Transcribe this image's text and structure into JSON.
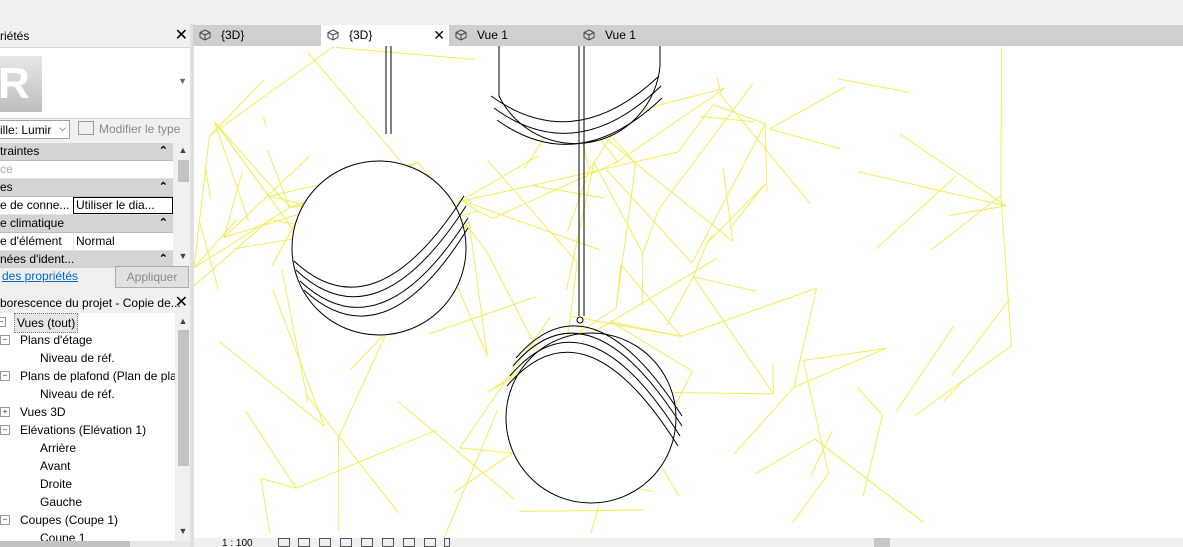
{
  "properties": {
    "title": "riétés",
    "close_icon": "close-icon",
    "family_type": "ille: Lumir",
    "edit_type": "Modifier le type",
    "groups": [
      {
        "label": "traintes",
        "rows": [
          {
            "name": "ce",
            "value": ""
          }
        ]
      },
      {
        "label": "es",
        "rows": [
          {
            "name": "e de conne...",
            "value": "Utiliser le dia..."
          }
        ]
      },
      {
        "label": "e climatique",
        "rows": [
          {
            "name": "e d'élément",
            "value": "Normal"
          }
        ]
      },
      {
        "label": "nées d'ident...",
        "rows": []
      }
    ],
    "help_link": "des propriétés",
    "apply": "Appliquer"
  },
  "browser": {
    "title": "borescence du projet - Copie de...",
    "items": [
      {
        "label": "Vues (tout)",
        "level": 0,
        "toggle": "-",
        "selected": true
      },
      {
        "label": "Plans d'étage",
        "level": 1,
        "toggle": "-"
      },
      {
        "label": "Niveau de réf.",
        "level": 2
      },
      {
        "label": "Plans de plafond (Plan de pla",
        "level": 1,
        "toggle": "-"
      },
      {
        "label": "Niveau de réf.",
        "level": 2
      },
      {
        "label": "Vues 3D",
        "level": 1,
        "toggle": "+"
      },
      {
        "label": "Elévations (Elévation 1)",
        "level": 1,
        "toggle": "-"
      },
      {
        "label": "Arrière",
        "level": 2
      },
      {
        "label": "Avant",
        "level": 2
      },
      {
        "label": "Droite",
        "level": 2
      },
      {
        "label": "Gauche",
        "level": 2
      },
      {
        "label": "Coupes (Coupe 1)",
        "level": 1,
        "toggle": "-"
      },
      {
        "label": "Coupe 1",
        "level": 2
      }
    ]
  },
  "tabs": [
    {
      "label": "{3D}",
      "active": false
    },
    {
      "label": "{3D}",
      "active": true
    },
    {
      "label": "Vue 1",
      "active": false
    },
    {
      "label": "Vue 1",
      "active": false
    }
  ],
  "status": {
    "scale": "1 : 100"
  },
  "colors": {
    "wireframe": "#f3ea3c",
    "lamp_stroke": "#000000",
    "tab_bar": "#cfcfcf"
  }
}
